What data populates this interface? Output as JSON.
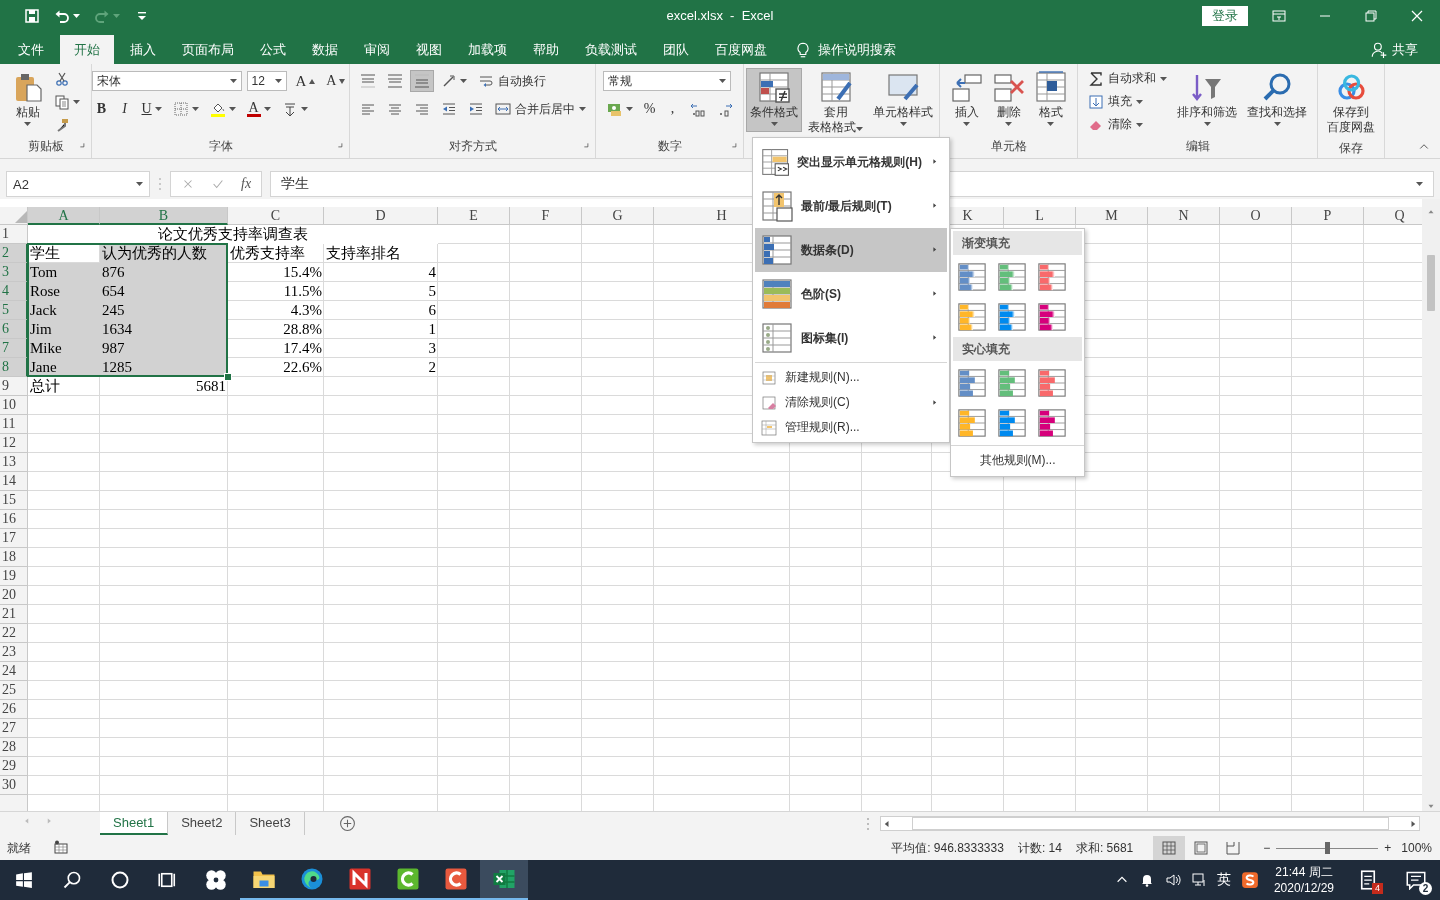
{
  "window": {
    "title": "excel.xlsx  -  Excel",
    "sign_in": "登录"
  },
  "quick_access": [
    {
      "disabled": false,
      "dropdown": false
    },
    {
      "disabled": false,
      "dropdown": true
    },
    {
      "disabled": true,
      "dropdown": true
    },
    {
      "disabled": false,
      "dropdown": false
    }
  ],
  "ribbon_tabs": [
    {
      "label": "文件",
      "selected": false
    },
    {
      "label": "开始",
      "selected": true
    },
    {
      "label": "插入",
      "selected": false
    },
    {
      "label": "页面布局",
      "selected": false
    },
    {
      "label": "公式",
      "selected": false
    },
    {
      "label": "数据",
      "selected": false
    },
    {
      "label": "审阅",
      "selected": false
    },
    {
      "label": "视图",
      "selected": false
    },
    {
      "label": "加载项",
      "selected": false
    },
    {
      "label": "帮助",
      "selected": false
    },
    {
      "label": "负载测试",
      "selected": false
    },
    {
      "label": "团队",
      "selected": false
    },
    {
      "label": "百度网盘",
      "selected": false
    }
  ],
  "tell_me": "操作说明搜索",
  "share": "共享",
  "ribbon": {
    "groups": [
      {
        "label": "剪贴板",
        "launcher": true,
        "parts": [
          {
            "kind": "large",
            "label": "粘贴",
            "dropdown": true
          },
          {
            "kind": "stack",
            "lines": [
              {
                "items": [
                  {
                    "kind": "icon"
                  }
                ]
              },
              {
                "items": [
                  {
                    "kind": "icon",
                    "dropdown": true
                  }
                ]
              },
              {
                "items": [
                  {
                    "kind": "icon"
                  }
                ]
              }
            ]
          }
        ]
      },
      {
        "label": "字体",
        "launcher": true,
        "parts": [
          {
            "kind": "stack",
            "lines": [
              {
                "items": [
                  {
                    "kind": "field",
                    "value": "宋体",
                    "dropdown": true
                  },
                  {
                    "kind": "field",
                    "value": "12",
                    "dropdown": true
                  },
                  {
                    "kind": "grow",
                    "label": "A"
                  },
                  {
                    "kind": "shrink",
                    "label": "A"
                  }
                ]
              },
              {
                "items": [
                  {
                    "kind": "bold",
                    "label": "B"
                  },
                  {
                    "kind": "italic",
                    "label": "I"
                  },
                  {
                    "kind": "underline",
                    "label": "U",
                    "dropdown": true
                  },
                  {
                    "kind": "icon",
                    "dropdown": true
                  },
                  {
                    "kind": "icon",
                    "dropdown": true
                  },
                  {
                    "kind": "font-color",
                    "label": "A",
                    "dropdown": true
                  },
                  {
                    "kind": "icon",
                    "dropdown": true
                  }
                ]
              }
            ]
          }
        ]
      },
      {
        "label": "对齐方式",
        "launcher": true,
        "parts": [
          {
            "kind": "stack",
            "lines": [
              {
                "items": [
                  {
                    "kind": "icon",
                    "selected": false
                  },
                  {
                    "kind": "icon",
                    "selected": false
                  },
                  {
                    "kind": "icon",
                    "selected": true
                  },
                  {
                    "kind": "icon",
                    "dropdown": true
                  },
                  {
                    "kind": "small",
                    "label": "自动换行"
                  }
                ]
              },
              {
                "items": [
                  {
                    "kind": "icon",
                    "selected": false
                  },
                  {
                    "kind": "icon",
                    "selected": false
                  },
                  {
                    "kind": "icon",
                    "selected": false
                  },
                  {
                    "kind": "icon"
                  },
                  {
                    "kind": "icon"
                  },
                  {
                    "kind": "small",
                    "label": "合并后居中",
                    "dropdown": true
                  }
                ]
              }
            ]
          }
        ]
      },
      {
        "label": "数字",
        "launcher": true,
        "parts": [
          {
            "kind": "stack",
            "lines": [
              {
                "items": [
                  {
                    "kind": "field",
                    "value": "常规",
                    "dropdown": true
                  }
                ]
              },
              {
                "items": [
                  {
                    "kind": "icon",
                    "dropdown": true
                  },
                  {
                    "kind": "text",
                    "label": "%"
                  },
                  {
                    "kind": "text",
                    "label": ","
                  },
                  {
                    "kind": "icon"
                  },
                  {
                    "kind": "icon"
                  }
                ]
              }
            ]
          }
        ]
      },
      {
        "parts": [
          {
            "kind": "large",
            "label": "条件格式",
            "dropdown": true,
            "pressed": true
          },
          {
            "kind": "large",
            "label": [
              "套用",
              "表格格式"
            ],
            "dropdown": true,
            "pressed": false
          },
          {
            "kind": "large",
            "label": "单元格样式",
            "dropdown": true,
            "pressed": false
          }
        ]
      },
      {
        "label": "单元格",
        "parts": [
          {
            "kind": "large",
            "label": "插入",
            "dropdown": true
          },
          {
            "kind": "large",
            "label": "删除",
            "dropdown": true
          },
          {
            "kind": "large",
            "label": "格式",
            "dropdown": true
          }
        ]
      },
      {
        "label": "编辑",
        "parts": [
          {
            "kind": "stack",
            "lines": [
              {
                "items": [
                  {
                    "kind": "small",
                    "label": "自动求和",
                    "dropdown": true
                  }
                ]
              },
              {
                "items": [
                  {
                    "kind": "small",
                    "label": "填充",
                    "dropdown": true
                  }
                ]
              },
              {
                "items": [
                  {
                    "kind": "small",
                    "label": "清除",
                    "dropdown": true
                  }
                ]
              }
            ]
          },
          {
            "kind": "large",
            "label": "排序和筛选",
            "dropdown": true
          },
          {
            "kind": "large",
            "label": "查找和选择",
            "dropdown": true
          }
        ]
      },
      {
        "label": "保存",
        "parts": [
          {
            "kind": "large",
            "label": [
              "保存到",
              "百度网盘"
            ]
          }
        ]
      }
    ]
  },
  "formula_bar": {
    "name_box": "A2",
    "function_label": "fx",
    "formula": "学生"
  },
  "sheet": {
    "columns": [
      {
        "label": "A",
        "selected": true
      },
      {
        "label": "B",
        "selected": true
      },
      {
        "label": "C",
        "selected": false
      },
      {
        "label": "D",
        "selected": false
      },
      {
        "label": "E",
        "selected": false
      },
      {
        "label": "F",
        "selected": false
      },
      {
        "label": "G",
        "selected": false
      },
      {
        "label": "H",
        "selected": false
      },
      {
        "label": "K",
        "selected": false
      },
      {
        "label": "L",
        "selected": false
      },
      {
        "label": "M",
        "selected": false
      },
      {
        "label": "N",
        "selected": false
      },
      {
        "label": "O",
        "selected": false
      },
      {
        "label": "P",
        "selected": false
      },
      {
        "label": "Q",
        "selected": false
      }
    ],
    "rows": [
      {
        "number": "1",
        "selected": false,
        "cells": [
          {
            "kind": "title",
            "text": "论文优秀支持率调查表"
          }
        ]
      },
      {
        "number": "2",
        "selected": true,
        "cells": [
          {
            "kind": "text",
            "text": "学生"
          },
          {
            "kind": "text",
            "text": "认为优秀的人数"
          },
          {
            "kind": "text",
            "text": "优秀支持率"
          },
          {
            "kind": "text",
            "text": "支持率排名"
          }
        ]
      },
      {
        "number": "3",
        "selected": true,
        "cells": [
          {
            "kind": "text",
            "text": "Tom"
          },
          {
            "kind": "text",
            "text": "876"
          },
          {
            "kind": "number",
            "text": "15.4%"
          },
          {
            "kind": "number",
            "text": "4"
          }
        ]
      },
      {
        "number": "4",
        "selected": true,
        "cells": [
          {
            "kind": "text",
            "text": "Rose"
          },
          {
            "kind": "text",
            "text": "654"
          },
          {
            "kind": "number",
            "text": "11.5%"
          },
          {
            "kind": "number",
            "text": "5"
          }
        ]
      },
      {
        "number": "5",
        "selected": true,
        "cells": [
          {
            "kind": "text",
            "text": "Jack"
          },
          {
            "kind": "text",
            "text": "245"
          },
          {
            "kind": "number",
            "text": "4.3%"
          },
          {
            "kind": "number",
            "text": "6"
          }
        ]
      },
      {
        "number": "6",
        "selected": true,
        "cells": [
          {
            "kind": "text",
            "text": "Jim"
          },
          {
            "kind": "text",
            "text": "1634"
          },
          {
            "kind": "number",
            "text": "28.8%"
          },
          {
            "kind": "number",
            "text": "1"
          }
        ]
      },
      {
        "number": "7",
        "selected": true,
        "cells": [
          {
            "kind": "text",
            "text": "Mike"
          },
          {
            "kind": "text",
            "text": "987"
          },
          {
            "kind": "number",
            "text": "17.4%"
          },
          {
            "kind": "number",
            "text": "3"
          }
        ]
      },
      {
        "number": "8",
        "selected": true,
        "cells": [
          {
            "kind": "text",
            "text": "Jane"
          },
          {
            "kind": "text",
            "text": "1285"
          },
          {
            "kind": "number",
            "text": "22.6%"
          },
          {
            "kind": "number",
            "text": "2"
          }
        ]
      },
      {
        "number": "9",
        "selected": false,
        "cells": [
          {
            "kind": "text",
            "text": "总计"
          },
          {
            "kind": "number",
            "text": "5681"
          }
        ]
      },
      {
        "number": "10",
        "selected": false
      },
      {
        "number": "11",
        "selected": false
      },
      {
        "number": "12",
        "selected": false
      },
      {
        "number": "13",
        "selected": false
      },
      {
        "number": "14",
        "selected": false
      },
      {
        "number": "15",
        "selected": false
      },
      {
        "number": "16",
        "selected": false
      },
      {
        "number": "17",
        "selected": false
      },
      {
        "number": "18",
        "selected": false
      },
      {
        "number": "19",
        "selected": false
      },
      {
        "number": "20",
        "selected": false
      },
      {
        "number": "21",
        "selected": false
      },
      {
        "number": "22",
        "selected": false
      },
      {
        "number": "23",
        "selected": false
      },
      {
        "number": "24",
        "selected": false
      },
      {
        "number": "25",
        "selected": false
      },
      {
        "number": "26",
        "selected": false
      },
      {
        "number": "27",
        "selected": false
      },
      {
        "number": "28",
        "selected": false
      },
      {
        "number": "29",
        "selected": false
      },
      {
        "number": "30",
        "selected": false
      }
    ]
  },
  "conditional_format_menu": {
    "items": [
      {
        "kind": "large",
        "label": "突出显示单元格规则(H)",
        "submenu": true,
        "selected": false
      },
      {
        "kind": "large",
        "label": "最前/最后规则(T)",
        "submenu": true,
        "selected": false
      },
      {
        "kind": "large",
        "label": "数据条(D)",
        "submenu": true,
        "selected": true
      },
      {
        "kind": "large",
        "label": "色阶(S)",
        "submenu": true,
        "selected": false
      },
      {
        "kind": "large",
        "label": "图标集(I)",
        "submenu": true,
        "selected": false
      },
      {
        "kind": "small",
        "label": "新建规则(N)...",
        "submenu": false,
        "selected": false
      },
      {
        "kind": "small",
        "label": "清除规则(C)",
        "submenu": true,
        "selected": false
      },
      {
        "kind": "small",
        "label": "管理规则(R)...",
        "submenu": false,
        "selected": false
      }
    ],
    "submenu": {
      "sections": [
        {
          "title": "渐变填充",
          "kind": "gradient",
          "swatches": [
            {
              "color": "#638ec6"
            },
            {
              "color": "#63be7b"
            },
            {
              "color": "#f8696b"
            },
            {
              "color": "#ffb628"
            },
            {
              "color": "#008aef"
            },
            {
              "color": "#d6007b"
            }
          ]
        },
        {
          "title": "实心填充",
          "kind": "solid",
          "swatches": [
            {
              "color": "#638ec6"
            },
            {
              "color": "#63be7b"
            },
            {
              "color": "#f8696b"
            },
            {
              "color": "#ffb628"
            },
            {
              "color": "#008aef"
            },
            {
              "color": "#d6007b"
            }
          ]
        }
      ],
      "more": "其他规则(M)..."
    }
  },
  "sheet_tabs": [
    {
      "label": "Sheet1",
      "selected": true
    },
    {
      "label": "Sheet2",
      "selected": false
    },
    {
      "label": "Sheet3",
      "selected": false
    }
  ],
  "status_bar": {
    "ready": "就绪",
    "stats": [
      "平均值: 946.8333333",
      "计数: 14",
      "求和: 5681"
    ],
    "views": [
      {
        "selected": true
      },
      {
        "selected": false
      },
      {
        "selected": false
      }
    ],
    "zoom_out": "−",
    "zoom_in": "+",
    "zoom": {
      "level": 0.5
    },
    "zoom_percent": "100%"
  },
  "taskbar": {
    "apps": [
      {
        "running": true,
        "active": false
      },
      {
        "running": true,
        "active": false
      },
      {
        "running": true,
        "active": false
      },
      {
        "running": true,
        "active": false
      },
      {
        "running": true,
        "active": false
      },
      {
        "running": true,
        "active": true
      }
    ],
    "ime": "英",
    "time": "21:44 周二",
    "date": "2020/12/29",
    "notes_badge": "4",
    "notifications_badge": "2"
  }
}
